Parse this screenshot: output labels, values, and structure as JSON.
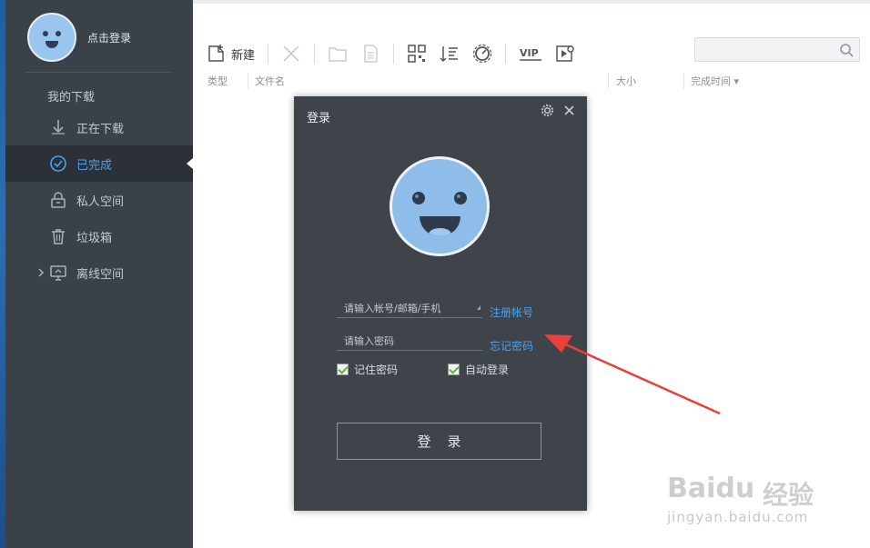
{
  "sidebar": {
    "login_link": "点击登录",
    "section_title": "我的下载",
    "items": [
      {
        "label": "正在下载",
        "icon": "download-arrow-icon"
      },
      {
        "label": "已完成",
        "icon": "check-circle-icon"
      },
      {
        "label": "私人空间",
        "icon": "lock-icon"
      },
      {
        "label": "垃圾箱",
        "icon": "trash-icon"
      },
      {
        "label": "离线空间",
        "icon": "cloud-monitor-icon"
      }
    ],
    "active_index": 1,
    "accent_color": "#4aa3ef"
  },
  "toolbar": {
    "new_label": "新建",
    "search_placeholder": ""
  },
  "columns": {
    "type": "类型",
    "filename": "文件名",
    "size": "大小",
    "completed_time": "完成时间"
  },
  "dialog": {
    "title": "登录",
    "account_placeholder": "请输入帐号/邮箱/手机",
    "password_placeholder": "请输入密码",
    "register_link": "注册帐号",
    "forgot_link": "忘记密码",
    "remember_label": "记住密码",
    "auto_login_label": "自动登录",
    "remember_checked": true,
    "auto_login_checked": true,
    "login_button": "登录"
  },
  "watermark": {
    "brand": "Baidu",
    "brand_cn": "经验",
    "url": "jingyan.baidu.com"
  }
}
